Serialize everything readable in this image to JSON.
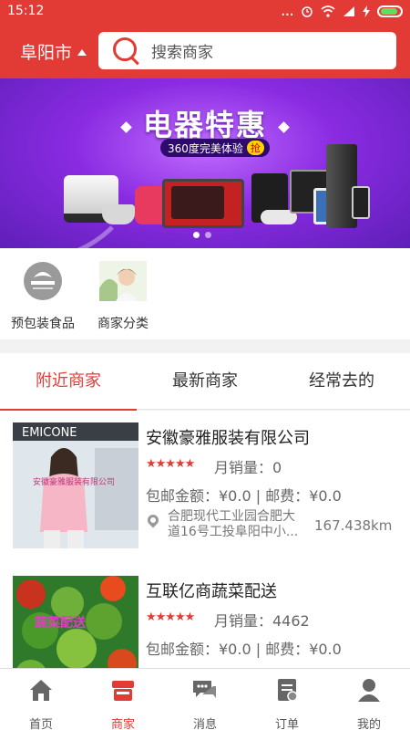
{
  "status_bar": {
    "time": "15:12",
    "signal_dots": "...",
    "battery_color": "#5ee05e"
  },
  "header": {
    "city": "阜阳市",
    "search_placeholder": "搜索商家"
  },
  "banner": {
    "title": "电器特惠",
    "subtitle": "360度完美体验",
    "subtitle_tag": "抢",
    "slides": 2,
    "active_slide": 1
  },
  "categories": [
    {
      "label": "预包装食品",
      "icon": "brand-logo-icon"
    },
    {
      "label": "商家分类",
      "icon": "person-photo-icon"
    }
  ],
  "tabs": [
    {
      "label": "附近商家",
      "active": true
    },
    {
      "label": "最新商家",
      "active": false
    },
    {
      "label": "经常去的",
      "active": false
    }
  ],
  "shops": [
    {
      "name": "安徽豪雅服装有限公司",
      "stars": "★★★★★",
      "rating": 5,
      "sales": "月销量：0",
      "fee": "包邮金额：¥0.0 | 邮费：¥0.0",
      "address": "合肥现代工业园合肥大道16号工投阜阳中小...",
      "distance": "167.438km",
      "thumb_text": "安徽豪雅服装有限公司",
      "thumb_sign": "EMICONE"
    },
    {
      "name": "互联亿商蔬菜配送",
      "stars": "★★★★★",
      "rating": 5,
      "sales": "月销量：4462",
      "fee": "包邮金额：¥0.0 | 邮费：¥0.0",
      "address": "",
      "distance": "",
      "thumb_text": "蔬菜配送",
      "thumb_sign": ""
    }
  ],
  "bottom_nav": [
    {
      "label": "首页",
      "icon": "home-icon",
      "active": false
    },
    {
      "label": "商家",
      "icon": "store-icon",
      "active": true
    },
    {
      "label": "消息",
      "icon": "message-icon",
      "active": false
    },
    {
      "label": "订单",
      "icon": "order-icon",
      "active": false
    },
    {
      "label": "我的",
      "icon": "user-icon",
      "active": false
    }
  ],
  "colors": {
    "primary": "#e23b36",
    "banner_purple": "#8a2be2",
    "banner_yellow": "#ffd400"
  }
}
